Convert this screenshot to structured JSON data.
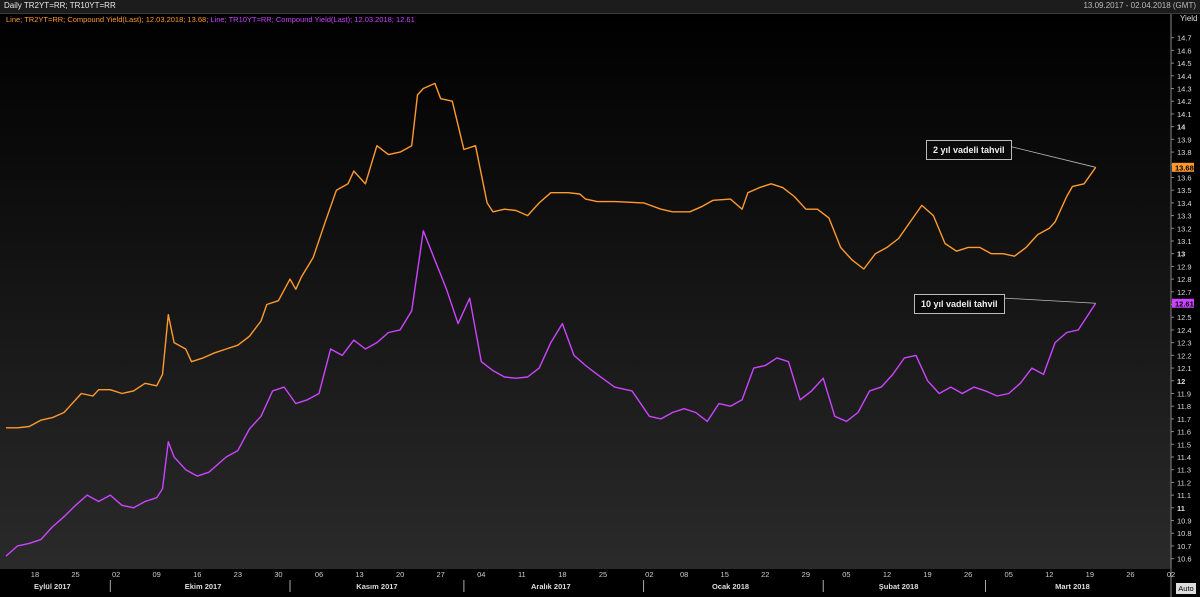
{
  "header": {
    "title": "Daily TR2YT=RR; TR10YT=RR",
    "date_range": "13.09.2017 - 02.04.2018 (GMT)"
  },
  "legend": {
    "line1": "Line; TR2YT=RR; Compound Yield(Last); 12.03.2018; 13.68;",
    "line2": "Line; TR10YT=RR; Compound Yield(Last); 12.03.2018; 12.61"
  },
  "annotations": {
    "two_year": "2 yıl vadeli tahvil",
    "ten_year": "10 yıl vadeli tahvil"
  },
  "axis": {
    "ylabel": "Yield",
    "auto_button": "Auto"
  },
  "colors": {
    "two_year": "#ff9a2e",
    "ten_year": "#cc44ff",
    "background": "#000000"
  },
  "chart_data": {
    "type": "line",
    "title": "",
    "ylabel": "Yield",
    "ylim": [
      10.55,
      14.8
    ],
    "grid": false,
    "x_range": [
      "2017-09-13",
      "2018-04-02"
    ],
    "ytick_values": [
      10.6,
      10.7,
      10.8,
      10.9,
      11,
      11.1,
      11.2,
      11.3,
      11.4,
      11.5,
      11.6,
      11.7,
      11.8,
      11.9,
      12,
      12.1,
      12.2,
      12.3,
      12.4,
      12.5,
      12.6,
      12.7,
      12.8,
      12.9,
      13,
      13.1,
      13.2,
      13.3,
      13.4,
      13.5,
      13.6,
      13.7,
      13.8,
      13.9,
      14,
      14.1,
      14.2,
      14.3,
      14.4,
      14.5,
      14.6,
      14.7
    ],
    "ytick_labels": [
      "10.6",
      "10.7",
      "10.8",
      "10.9",
      "11",
      "11.1",
      "11.2",
      "11.3",
      "11.4",
      "11.5",
      "11.6",
      "11.7",
      "11.8",
      "11.9",
      "12",
      "12.1",
      "12.2",
      "12.3",
      "12.4",
      "12.5",
      "12.6",
      "12.7",
      "12.8",
      "12.9",
      "13",
      "13.1",
      "13.2",
      "13.3",
      "13.4",
      "13.5",
      "13.6",
      "13.7",
      "13.8",
      "13.9",
      "14",
      "14.1",
      "14.2",
      "14.3",
      "14.4",
      "14.5",
      "14.6",
      "14.7"
    ],
    "ytick_bold": [
      "11",
      "12",
      "13",
      "14"
    ],
    "xticks": [
      {
        "date": "2017-09-18",
        "label": "18"
      },
      {
        "date": "2017-09-25",
        "label": "25"
      },
      {
        "date": "2017-10-02",
        "label": "02"
      },
      {
        "date": "2017-10-09",
        "label": "09"
      },
      {
        "date": "2017-10-16",
        "label": "16"
      },
      {
        "date": "2017-10-23",
        "label": "23"
      },
      {
        "date": "2017-10-30",
        "label": "30"
      },
      {
        "date": "2017-11-06",
        "label": "06"
      },
      {
        "date": "2017-11-13",
        "label": "13"
      },
      {
        "date": "2017-11-20",
        "label": "20"
      },
      {
        "date": "2017-11-27",
        "label": "27"
      },
      {
        "date": "2017-12-04",
        "label": "04"
      },
      {
        "date": "2017-12-11",
        "label": "11"
      },
      {
        "date": "2017-12-18",
        "label": "18"
      },
      {
        "date": "2017-12-25",
        "label": "25"
      },
      {
        "date": "2018-01-02",
        "label": "02"
      },
      {
        "date": "2018-01-08",
        "label": "08"
      },
      {
        "date": "2018-01-15",
        "label": "15"
      },
      {
        "date": "2018-01-22",
        "label": "22"
      },
      {
        "date": "2018-01-29",
        "label": "29"
      },
      {
        "date": "2018-02-05",
        "label": "05"
      },
      {
        "date": "2018-02-12",
        "label": "12"
      },
      {
        "date": "2018-02-19",
        "label": "19"
      },
      {
        "date": "2018-02-26",
        "label": "26"
      },
      {
        "date": "2018-03-05",
        "label": "05"
      },
      {
        "date": "2018-03-12",
        "label": "12"
      },
      {
        "date": "2018-03-19",
        "label": "19"
      },
      {
        "date": "2018-03-26",
        "label": "26"
      },
      {
        "date": "2018-04-02",
        "label": "02"
      }
    ],
    "months": [
      {
        "label": "Eylül 2017",
        "mid": "2017-09-21",
        "end": "2017-10-01"
      },
      {
        "label": "Ekim 2017",
        "mid": "2017-10-17",
        "end": "2017-11-01"
      },
      {
        "label": "Kasım 2017",
        "mid": "2017-11-16",
        "end": "2017-12-01"
      },
      {
        "label": "Aralık 2017",
        "mid": "2017-12-16",
        "end": "2018-01-01"
      },
      {
        "label": "Ocak 2018",
        "mid": "2018-01-16",
        "end": "2018-02-01"
      },
      {
        "label": "Şubat 2018",
        "mid": "2018-02-14",
        "end": "2018-03-01"
      },
      {
        "label": "Mart 2018",
        "mid": "2018-03-16",
        "end": null
      }
    ],
    "series": [
      {
        "name": "TR2YT=RR",
        "last_label": "13.68",
        "points": [
          [
            "2017-09-13",
            11.63
          ],
          [
            "2017-09-15",
            11.63
          ],
          [
            "2017-09-17",
            11.64
          ],
          [
            "2017-09-19",
            11.69
          ],
          [
            "2017-09-21",
            11.71
          ],
          [
            "2017-09-23",
            11.75
          ],
          [
            "2017-09-24",
            11.8
          ],
          [
            "2017-09-26",
            11.9
          ],
          [
            "2017-09-28",
            11.88
          ],
          [
            "2017-09-29",
            11.93
          ],
          [
            "2017-10-01",
            11.93
          ],
          [
            "2017-10-03",
            11.9
          ],
          [
            "2017-10-05",
            11.92
          ],
          [
            "2017-10-07",
            11.98
          ],
          [
            "2017-10-09",
            11.96
          ],
          [
            "2017-10-10",
            12.05
          ],
          [
            "2017-10-11",
            12.52
          ],
          [
            "2017-10-12",
            12.3
          ],
          [
            "2017-10-14",
            12.25
          ],
          [
            "2017-10-15",
            12.15
          ],
          [
            "2017-10-17",
            12.18
          ],
          [
            "2017-10-19",
            12.22
          ],
          [
            "2017-10-21",
            12.25
          ],
          [
            "2017-10-23",
            12.28
          ],
          [
            "2017-10-25",
            12.35
          ],
          [
            "2017-10-27",
            12.47
          ],
          [
            "2017-10-28",
            12.6
          ],
          [
            "2017-10-30",
            12.63
          ],
          [
            "2017-11-01",
            12.8
          ],
          [
            "2017-11-02",
            12.72
          ],
          [
            "2017-11-03",
            12.82
          ],
          [
            "2017-11-05",
            12.97
          ],
          [
            "2017-11-07",
            13.24
          ],
          [
            "2017-11-09",
            13.5
          ],
          [
            "2017-11-11",
            13.55
          ],
          [
            "2017-11-12",
            13.65
          ],
          [
            "2017-11-14",
            13.55
          ],
          [
            "2017-11-16",
            13.85
          ],
          [
            "2017-11-18",
            13.78
          ],
          [
            "2017-11-20",
            13.8
          ],
          [
            "2017-11-22",
            13.85
          ],
          [
            "2017-11-23",
            14.25
          ],
          [
            "2017-11-24",
            14.3
          ],
          [
            "2017-11-26",
            14.34
          ],
          [
            "2017-11-27",
            14.22
          ],
          [
            "2017-11-29",
            14.2
          ],
          [
            "2017-12-01",
            13.82
          ],
          [
            "2017-12-03",
            13.85
          ],
          [
            "2017-12-05",
            13.4
          ],
          [
            "2017-12-06",
            13.33
          ],
          [
            "2017-12-08",
            13.35
          ],
          [
            "2017-12-10",
            13.34
          ],
          [
            "2017-12-12",
            13.3
          ],
          [
            "2017-12-14",
            13.4
          ],
          [
            "2017-12-16",
            13.48
          ],
          [
            "2017-12-19",
            13.48
          ],
          [
            "2017-12-21",
            13.47
          ],
          [
            "2017-12-22",
            13.43
          ],
          [
            "2017-12-24",
            13.41
          ],
          [
            "2017-12-27",
            13.41
          ],
          [
            "2018-01-01",
            13.4
          ],
          [
            "2018-01-04",
            13.35
          ],
          [
            "2018-01-06",
            13.33
          ],
          [
            "2018-01-09",
            13.33
          ],
          [
            "2018-01-11",
            13.37
          ],
          [
            "2018-01-13",
            13.42
          ],
          [
            "2018-01-16",
            13.43
          ],
          [
            "2018-01-18",
            13.35
          ],
          [
            "2018-01-19",
            13.48
          ],
          [
            "2018-01-21",
            13.52
          ],
          [
            "2018-01-23",
            13.55
          ],
          [
            "2018-01-25",
            13.52
          ],
          [
            "2018-01-27",
            13.45
          ],
          [
            "2018-01-29",
            13.35
          ],
          [
            "2018-01-31",
            13.35
          ],
          [
            "2018-02-02",
            13.28
          ],
          [
            "2018-02-04",
            13.05
          ],
          [
            "2018-02-06",
            12.95
          ],
          [
            "2018-02-08",
            12.88
          ],
          [
            "2018-02-10",
            13.0
          ],
          [
            "2018-02-12",
            13.05
          ],
          [
            "2018-02-14",
            13.12
          ],
          [
            "2018-02-16",
            13.25
          ],
          [
            "2018-02-18",
            13.38
          ],
          [
            "2018-02-20",
            13.3
          ],
          [
            "2018-02-22",
            13.08
          ],
          [
            "2018-02-24",
            13.02
          ],
          [
            "2018-02-26",
            13.05
          ],
          [
            "2018-02-28",
            13.05
          ],
          [
            "2018-03-02",
            13.0
          ],
          [
            "2018-03-04",
            13.0
          ],
          [
            "2018-03-06",
            12.98
          ],
          [
            "2018-03-08",
            13.05
          ],
          [
            "2018-03-10",
            13.15
          ],
          [
            "2018-03-12",
            13.2
          ],
          [
            "2018-03-13",
            13.25
          ],
          [
            "2018-03-15",
            13.45
          ],
          [
            "2018-03-16",
            13.53
          ],
          [
            "2018-03-18",
            13.55
          ],
          [
            "2018-03-20",
            13.68
          ]
        ]
      },
      {
        "name": "TR10YT=RR",
        "last_label": "12.61",
        "points": [
          [
            "2017-09-13",
            10.62
          ],
          [
            "2017-09-15",
            10.7
          ],
          [
            "2017-09-17",
            10.72
          ],
          [
            "2017-09-19",
            10.75
          ],
          [
            "2017-09-21",
            10.85
          ],
          [
            "2017-09-23",
            10.93
          ],
          [
            "2017-09-25",
            11.02
          ],
          [
            "2017-09-27",
            11.1
          ],
          [
            "2017-09-29",
            11.05
          ],
          [
            "2017-10-01",
            11.1
          ],
          [
            "2017-10-03",
            11.02
          ],
          [
            "2017-10-05",
            11.0
          ],
          [
            "2017-10-07",
            11.05
          ],
          [
            "2017-10-09",
            11.08
          ],
          [
            "2017-10-10",
            11.15
          ],
          [
            "2017-10-11",
            11.52
          ],
          [
            "2017-10-12",
            11.4
          ],
          [
            "2017-10-14",
            11.3
          ],
          [
            "2017-10-16",
            11.25
          ],
          [
            "2017-10-18",
            11.28
          ],
          [
            "2017-10-21",
            11.4
          ],
          [
            "2017-10-23",
            11.45
          ],
          [
            "2017-10-25",
            11.62
          ],
          [
            "2017-10-27",
            11.72
          ],
          [
            "2017-10-29",
            11.92
          ],
          [
            "2017-10-31",
            11.95
          ],
          [
            "2017-11-02",
            11.82
          ],
          [
            "2017-11-04",
            11.85
          ],
          [
            "2017-11-06",
            11.9
          ],
          [
            "2017-11-08",
            12.25
          ],
          [
            "2017-11-10",
            12.2
          ],
          [
            "2017-11-12",
            12.32
          ],
          [
            "2017-11-14",
            12.25
          ],
          [
            "2017-11-16",
            12.3
          ],
          [
            "2017-11-18",
            12.38
          ],
          [
            "2017-11-20",
            12.4
          ],
          [
            "2017-11-22",
            12.55
          ],
          [
            "2017-11-24",
            13.18
          ],
          [
            "2017-11-26",
            12.95
          ],
          [
            "2017-11-28",
            12.72
          ],
          [
            "2017-11-30",
            12.45
          ],
          [
            "2017-12-02",
            12.65
          ],
          [
            "2017-12-04",
            12.15
          ],
          [
            "2017-12-06",
            12.08
          ],
          [
            "2017-12-08",
            12.03
          ],
          [
            "2017-12-10",
            12.02
          ],
          [
            "2017-12-12",
            12.03
          ],
          [
            "2017-12-14",
            12.1
          ],
          [
            "2017-12-16",
            12.3
          ],
          [
            "2017-12-18",
            12.45
          ],
          [
            "2017-12-20",
            12.2
          ],
          [
            "2017-12-22",
            12.12
          ],
          [
            "2017-12-24",
            12.05
          ],
          [
            "2017-12-27",
            11.95
          ],
          [
            "2017-12-30",
            11.92
          ],
          [
            "2018-01-02",
            11.72
          ],
          [
            "2018-01-04",
            11.7
          ],
          [
            "2018-01-06",
            11.75
          ],
          [
            "2018-01-08",
            11.78
          ],
          [
            "2018-01-10",
            11.75
          ],
          [
            "2018-01-12",
            11.68
          ],
          [
            "2018-01-14",
            11.82
          ],
          [
            "2018-01-16",
            11.8
          ],
          [
            "2018-01-18",
            11.85
          ],
          [
            "2018-01-20",
            12.1
          ],
          [
            "2018-01-22",
            12.12
          ],
          [
            "2018-01-24",
            12.18
          ],
          [
            "2018-01-26",
            12.15
          ],
          [
            "2018-01-28",
            11.85
          ],
          [
            "2018-01-30",
            11.92
          ],
          [
            "2018-02-01",
            12.02
          ],
          [
            "2018-02-03",
            11.72
          ],
          [
            "2018-02-05",
            11.68
          ],
          [
            "2018-02-07",
            11.75
          ],
          [
            "2018-02-09",
            11.92
          ],
          [
            "2018-02-11",
            11.95
          ],
          [
            "2018-02-13",
            12.05
          ],
          [
            "2018-02-15",
            12.18
          ],
          [
            "2018-02-17",
            12.2
          ],
          [
            "2018-02-19",
            12.0
          ],
          [
            "2018-02-21",
            11.9
          ],
          [
            "2018-02-23",
            11.95
          ],
          [
            "2018-02-25",
            11.9
          ],
          [
            "2018-02-27",
            11.95
          ],
          [
            "2018-03-01",
            11.92
          ],
          [
            "2018-03-03",
            11.88
          ],
          [
            "2018-03-05",
            11.9
          ],
          [
            "2018-03-07",
            11.98
          ],
          [
            "2018-03-09",
            12.1
          ],
          [
            "2018-03-11",
            12.05
          ],
          [
            "2018-03-13",
            12.3
          ],
          [
            "2018-03-15",
            12.38
          ],
          [
            "2018-03-17",
            12.4
          ],
          [
            "2018-03-20",
            12.61
          ]
        ]
      }
    ]
  }
}
